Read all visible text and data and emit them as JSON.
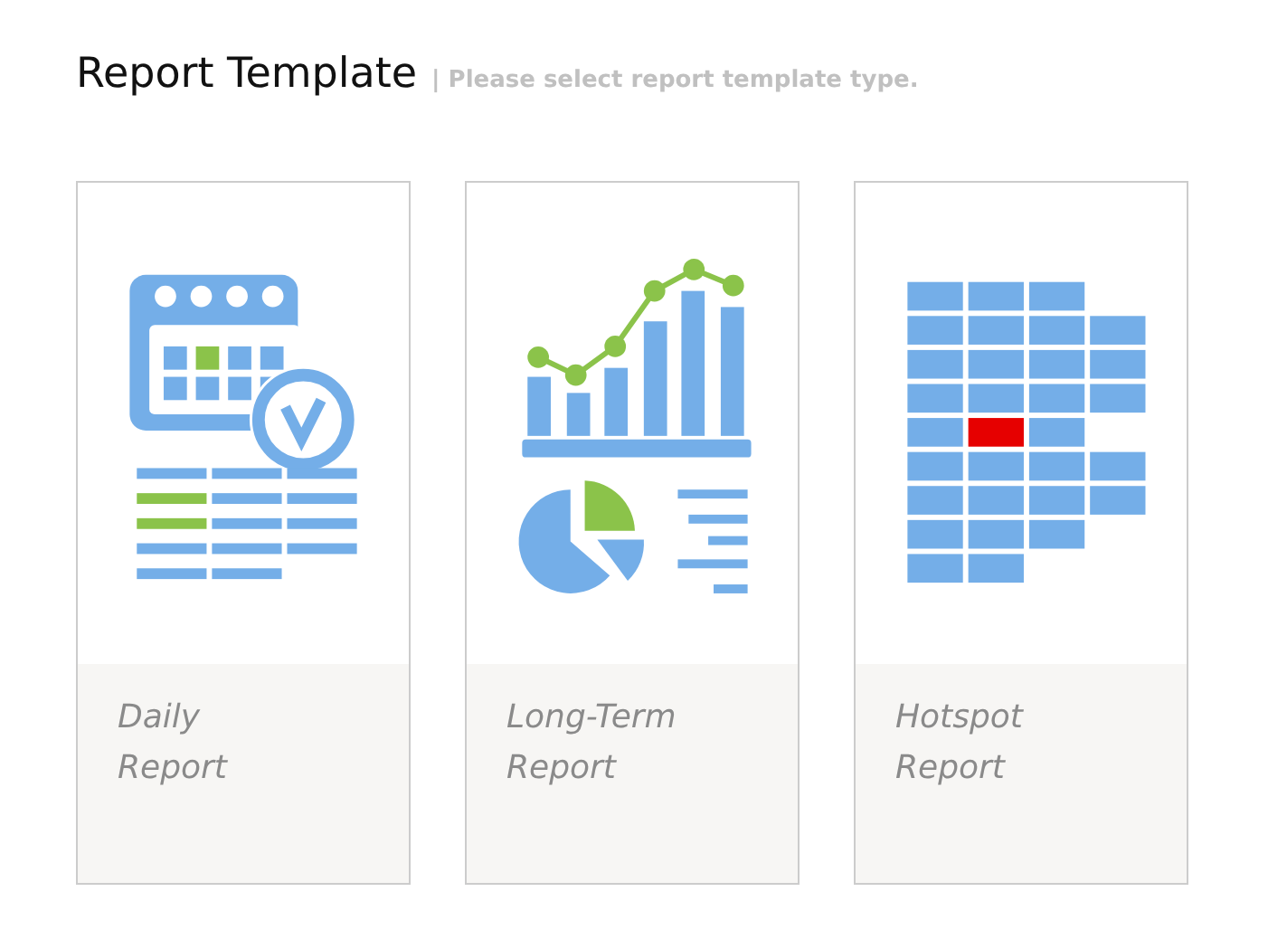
{
  "header": {
    "title": "Report Template",
    "subtitle": "| Please select report template type."
  },
  "templates": [
    {
      "kind": "calendar",
      "label": "Daily Report"
    },
    {
      "kind": "chart",
      "label": "Long-Term Report"
    },
    {
      "kind": "heatmap",
      "label": "Hotspot Report"
    }
  ]
}
